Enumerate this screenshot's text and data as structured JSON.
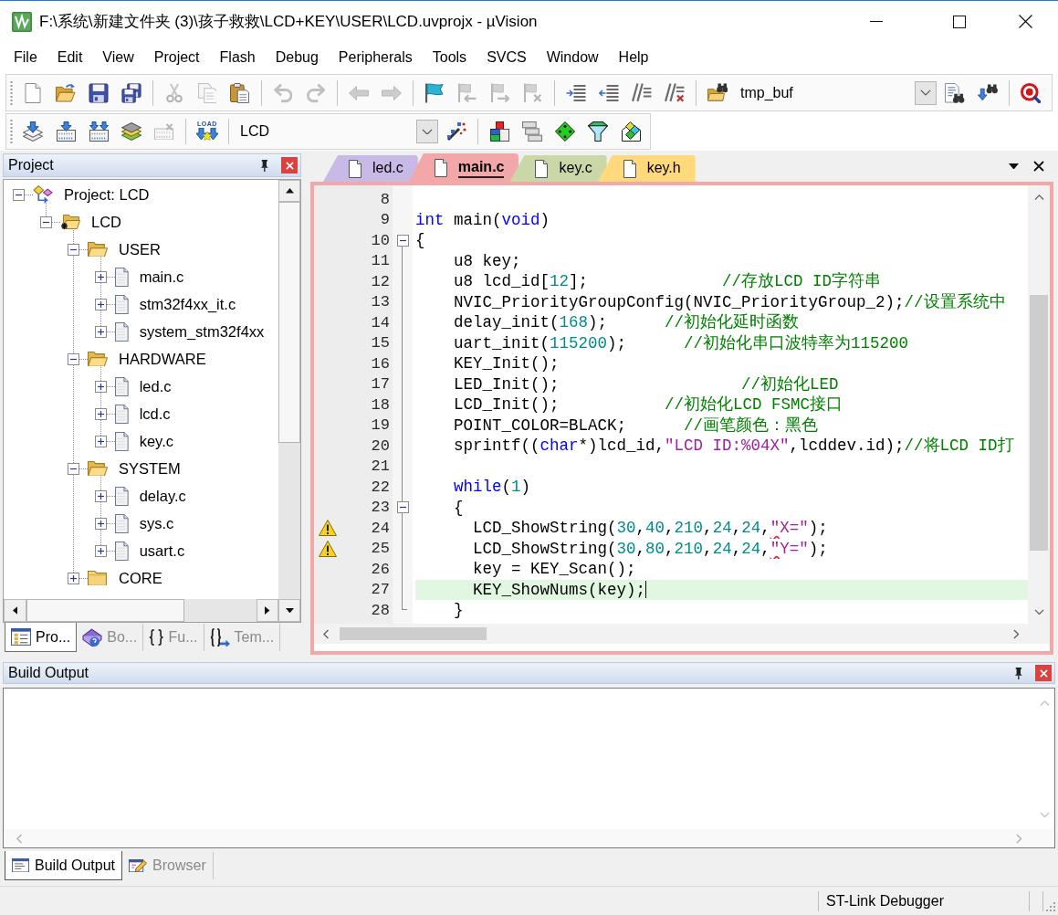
{
  "window": {
    "title": "F:\\系统\\新建文件夹 (3)\\孩子救救\\LCD+KEY\\USER\\LCD.uvprojx - µVision"
  },
  "menu": [
    {
      "label": "File"
    },
    {
      "label": "Edit"
    },
    {
      "label": "View"
    },
    {
      "label": "Project"
    },
    {
      "label": "Flash"
    },
    {
      "label": "Debug"
    },
    {
      "label": "Peripherals"
    },
    {
      "label": "Tools"
    },
    {
      "label": "SVCS"
    },
    {
      "label": "Window"
    },
    {
      "label": "Help"
    }
  ],
  "toolbar_1": {
    "items": [
      {
        "kind": "button",
        "disabled": false
      },
      {
        "kind": "button",
        "disabled": false
      },
      {
        "kind": "button",
        "disabled": false
      },
      {
        "kind": "button",
        "disabled": false
      },
      {
        "kind": "separator"
      },
      {
        "kind": "button",
        "disabled": true
      },
      {
        "kind": "button",
        "disabled": true
      },
      {
        "kind": "button",
        "disabled": false
      },
      {
        "kind": "separator"
      },
      {
        "kind": "button",
        "disabled": true
      },
      {
        "kind": "button",
        "disabled": true
      },
      {
        "kind": "separator"
      },
      {
        "kind": "button",
        "disabled": true
      },
      {
        "kind": "button",
        "disabled": true
      },
      {
        "kind": "separator"
      },
      {
        "kind": "button",
        "disabled": false
      },
      {
        "kind": "button",
        "disabled": true
      },
      {
        "kind": "button",
        "disabled": true
      },
      {
        "kind": "button",
        "disabled": true
      },
      {
        "kind": "separator"
      },
      {
        "kind": "button",
        "disabled": false
      },
      {
        "kind": "button",
        "disabled": false
      },
      {
        "kind": "button",
        "disabled": false
      },
      {
        "kind": "button",
        "disabled": false
      },
      {
        "kind": "separator"
      },
      {
        "kind": "button",
        "disabled": false
      },
      {
        "kind": "combo",
        "value": "tmp_buf"
      },
      {
        "kind": "button",
        "disabled": false
      },
      {
        "kind": "button",
        "disabled": false
      },
      {
        "kind": "separator"
      },
      {
        "kind": "button",
        "disabled": false
      }
    ]
  },
  "toolbar_2": {
    "items": [
      {
        "kind": "button",
        "disabled": false
      },
      {
        "kind": "button",
        "disabled": false
      },
      {
        "kind": "button",
        "disabled": false
      },
      {
        "kind": "button",
        "disabled": false
      },
      {
        "kind": "button",
        "disabled": true
      },
      {
        "kind": "separator"
      },
      {
        "kind": "button",
        "disabled": false,
        "label": "LOAD"
      },
      {
        "kind": "separator"
      },
      {
        "kind": "combo",
        "value": "LCD"
      },
      {
        "kind": "button",
        "disabled": false
      },
      {
        "kind": "separator"
      },
      {
        "kind": "button",
        "disabled": false
      },
      {
        "kind": "button",
        "disabled": false
      },
      {
        "kind": "button",
        "disabled": false
      },
      {
        "kind": "button",
        "disabled": false
      },
      {
        "kind": "button",
        "disabled": false
      }
    ]
  },
  "project_panel": {
    "title": "Project",
    "tree": [
      {
        "label": "Project: LCD",
        "kind": "project",
        "expanded": true,
        "children": [
          {
            "label": "LCD",
            "kind": "target",
            "expanded": true,
            "children": [
              {
                "label": "USER",
                "kind": "group",
                "expanded": true,
                "children": [
                  {
                    "label": "main.c",
                    "kind": "file",
                    "expanded": false
                  },
                  {
                    "label": "stm32f4xx_it.c",
                    "kind": "file",
                    "expanded": false
                  },
                  {
                    "label": "system_stm32f4xx",
                    "kind": "file",
                    "expanded": false
                  }
                ]
              },
              {
                "label": "HARDWARE",
                "kind": "group",
                "expanded": true,
                "children": [
                  {
                    "label": "led.c",
                    "kind": "file",
                    "expanded": false
                  },
                  {
                    "label": "lcd.c",
                    "kind": "file",
                    "expanded": false
                  },
                  {
                    "label": "key.c",
                    "kind": "file",
                    "expanded": false
                  }
                ]
              },
              {
                "label": "SYSTEM",
                "kind": "group",
                "expanded": true,
                "children": [
                  {
                    "label": "delay.c",
                    "kind": "file",
                    "expanded": false
                  },
                  {
                    "label": "sys.c",
                    "kind": "file",
                    "expanded": false
                  },
                  {
                    "label": "usart.c",
                    "kind": "file",
                    "expanded": false
                  }
                ]
              },
              {
                "label": "CORE",
                "kind": "group",
                "expanded": false
              }
            ]
          }
        ]
      }
    ],
    "tabs": [
      {
        "label": "Pro...",
        "selected": true
      },
      {
        "label": "Bo...",
        "selected": false
      },
      {
        "label": "Fu...",
        "selected": false
      },
      {
        "label": "Tem...",
        "selected": false
      }
    ]
  },
  "editor": {
    "tabs": [
      {
        "label": "led.c",
        "color": "#c9b9e6",
        "selected": false
      },
      {
        "label": "main.c",
        "color": "#f2a8a8",
        "selected": true
      },
      {
        "label": "key.c",
        "color": "#c9d8a6",
        "selected": false
      },
      {
        "label": "key.h",
        "color": "#ffd97c",
        "selected": false
      }
    ],
    "lines": [
      {
        "number": "8",
        "warning": false,
        "current": false
      },
      {
        "number": "9",
        "warning": false,
        "current": false,
        "tokens": [
          {
            "text": "int",
            "kind": "keyword"
          },
          {
            "text": " main(",
            "kind": "plain"
          },
          {
            "text": "void",
            "kind": "keyword"
          },
          {
            "text": ")",
            "kind": "plain"
          }
        ]
      },
      {
        "number": "10",
        "warning": false,
        "current": false,
        "fold_start": true,
        "tokens": [
          {
            "text": "{",
            "kind": "plain"
          }
        ]
      },
      {
        "number": "11",
        "warning": false,
        "current": false,
        "tokens": [
          {
            "text": "    u8 key;",
            "kind": "plain"
          }
        ]
      },
      {
        "number": "12",
        "warning": false,
        "current": false,
        "tokens": [
          {
            "text": "    u8 lcd_id[",
            "kind": "plain"
          },
          {
            "text": "12",
            "kind": "number"
          },
          {
            "text": "];              ",
            "kind": "plain"
          },
          {
            "text": "//存放LCD ID字符串",
            "kind": "comment"
          }
        ]
      },
      {
        "number": "13",
        "warning": false,
        "current": false,
        "tokens": [
          {
            "text": "    NVIC_PriorityGroupConfig(NVIC_PriorityGroup_2);",
            "kind": "plain"
          },
          {
            "text": "//设置系统中",
            "kind": "comment"
          }
        ]
      },
      {
        "number": "14",
        "warning": false,
        "current": false,
        "tokens": [
          {
            "text": "    delay_init(",
            "kind": "plain"
          },
          {
            "text": "168",
            "kind": "number"
          },
          {
            "text": ");      ",
            "kind": "plain"
          },
          {
            "text": "//初始化延时函数",
            "kind": "comment"
          }
        ]
      },
      {
        "number": "15",
        "warning": false,
        "current": false,
        "tokens": [
          {
            "text": "    uart_init(",
            "kind": "plain"
          },
          {
            "text": "115200",
            "kind": "number"
          },
          {
            "text": ");      ",
            "kind": "plain"
          },
          {
            "text": "//初始化串口波特率为115200",
            "kind": "comment"
          }
        ]
      },
      {
        "number": "16",
        "warning": false,
        "current": false,
        "tokens": [
          {
            "text": "    KEY_Init();",
            "kind": "plain"
          }
        ]
      },
      {
        "number": "17",
        "warning": false,
        "current": false,
        "tokens": [
          {
            "text": "    LED_Init();                   ",
            "kind": "plain"
          },
          {
            "text": "//初始化LED",
            "kind": "comment"
          }
        ]
      },
      {
        "number": "18",
        "warning": false,
        "current": false,
        "tokens": [
          {
            "text": "    LCD_Init();           ",
            "kind": "plain"
          },
          {
            "text": "//初始化LCD FSMC接口",
            "kind": "comment"
          }
        ]
      },
      {
        "number": "19",
        "warning": false,
        "current": false,
        "tokens": [
          {
            "text": "    POINT_COLOR=BLACK;      ",
            "kind": "plain"
          },
          {
            "text": "//画笔颜色：黑色",
            "kind": "comment"
          }
        ]
      },
      {
        "number": "20",
        "warning": false,
        "current": false,
        "tokens": [
          {
            "text": "    sprintf((",
            "kind": "plain"
          },
          {
            "text": "char",
            "kind": "keyword"
          },
          {
            "text": "*)lcd_id,",
            "kind": "plain"
          },
          {
            "text": "\"LCD ID:%04X\"",
            "kind": "string"
          },
          {
            "text": ",lcddev.id);",
            "kind": "plain"
          },
          {
            "text": "//将LCD ID打",
            "kind": "comment"
          }
        ]
      },
      {
        "number": "21",
        "warning": false,
        "current": false
      },
      {
        "number": "22",
        "warning": false,
        "current": false,
        "tokens": [
          {
            "text": "    while",
            "kind": "keyword"
          },
          {
            "text": "(",
            "kind": "plain"
          },
          {
            "text": "1",
            "kind": "number"
          },
          {
            "text": ")",
            "kind": "plain"
          }
        ]
      },
      {
        "number": "23",
        "warning": false,
        "current": false,
        "fold_start": true,
        "tokens": [
          {
            "text": "    {",
            "kind": "plain"
          }
        ]
      },
      {
        "number": "24",
        "warning": true,
        "current": false,
        "tokens": [
          {
            "text": "      LCD_ShowString(",
            "kind": "plain"
          },
          {
            "text": "30",
            "kind": "number"
          },
          {
            "text": ",",
            "kind": "plain"
          },
          {
            "text": "40",
            "kind": "number"
          },
          {
            "text": ",",
            "kind": "plain"
          },
          {
            "text": "210",
            "kind": "number"
          },
          {
            "text": ",",
            "kind": "plain"
          },
          {
            "text": "24",
            "kind": "number"
          },
          {
            "text": ",",
            "kind": "plain"
          },
          {
            "text": "24",
            "kind": "number"
          },
          {
            "text": ",",
            "kind": "plain"
          },
          {
            "text": "\"",
            "kind": "string",
            "squiggle": true
          },
          {
            "text": "X=\"",
            "kind": "string"
          },
          {
            "text": ");",
            "kind": "plain"
          }
        ]
      },
      {
        "number": "25",
        "warning": true,
        "current": false,
        "tokens": [
          {
            "text": "      LCD_ShowString(",
            "kind": "plain"
          },
          {
            "text": "30",
            "kind": "number"
          },
          {
            "text": ",",
            "kind": "plain"
          },
          {
            "text": "80",
            "kind": "number"
          },
          {
            "text": ",",
            "kind": "plain"
          },
          {
            "text": "210",
            "kind": "number"
          },
          {
            "text": ",",
            "kind": "plain"
          },
          {
            "text": "24",
            "kind": "number"
          },
          {
            "text": ",",
            "kind": "plain"
          },
          {
            "text": "24",
            "kind": "number"
          },
          {
            "text": ",",
            "kind": "plain"
          },
          {
            "text": "\"",
            "kind": "string",
            "squiggle": true
          },
          {
            "text": "Y=\"",
            "kind": "string"
          },
          {
            "text": ");",
            "kind": "plain"
          }
        ]
      },
      {
        "number": "26",
        "warning": false,
        "current": false,
        "tokens": [
          {
            "text": "      key = KEY_Scan();",
            "kind": "plain"
          }
        ]
      },
      {
        "number": "27",
        "warning": false,
        "current": true,
        "tokens": [
          {
            "text": "      KEY_ShowNums(key);",
            "kind": "plain"
          }
        ]
      },
      {
        "number": "28",
        "warning": false,
        "current": false,
        "fold_end": true,
        "tokens": [
          {
            "text": "    }",
            "kind": "plain"
          }
        ]
      }
    ]
  },
  "build_output": {
    "title": "Build Output",
    "tabs": [
      {
        "label": "Build Output",
        "selected": true
      },
      {
        "label": "Browser",
        "selected": false
      }
    ]
  },
  "status_bar": {
    "text": "ST-Link Debugger"
  }
}
